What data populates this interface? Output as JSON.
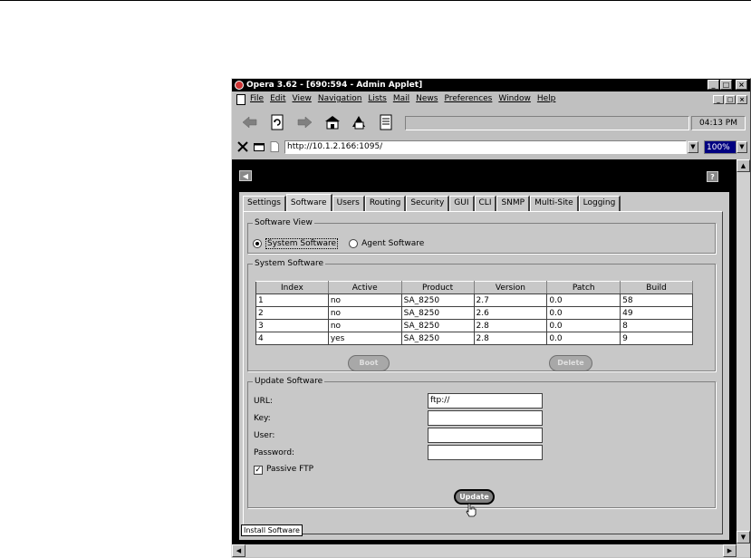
{
  "window": {
    "title": "Opera 3.62 - [690:594 - Admin Applet]",
    "controls": [
      "_",
      "□",
      "×"
    ]
  },
  "menu": {
    "items": [
      "File",
      "Edit",
      "View",
      "Navigation",
      "Lists",
      "Mail",
      "News",
      "Preferences",
      "Window",
      "Help"
    ]
  },
  "toolbar": {
    "icons": [
      "back-arrow-icon",
      "reload-icon",
      "forward-arrow-icon",
      "home-icon",
      "hotlist-icon",
      "notes-icon"
    ],
    "clock": "04:13 PM"
  },
  "address": {
    "url": "http://10.1.2.166:1095/",
    "zoom": "100%"
  },
  "applet": {
    "tabs": [
      "Settings",
      "Software",
      "Users",
      "Routing",
      "Security",
      "GUI",
      "CLI",
      "SNMP",
      "Multi-Site",
      "Logging"
    ],
    "active_tab": "Software",
    "software_view": {
      "legend": "Software View",
      "options": [
        "System Software",
        "Agent Software"
      ],
      "selected": "System Software"
    },
    "system_software": {
      "legend": "System Software",
      "columns": [
        "Index",
        "Active",
        "Product",
        "Version",
        "Patch",
        "Build"
      ],
      "rows": [
        [
          "1",
          "no",
          "SA_8250",
          "2.7",
          "0.0",
          "58"
        ],
        [
          "2",
          "no",
          "SA_8250",
          "2.6",
          "0.0",
          "49"
        ],
        [
          "3",
          "no",
          "SA_8250",
          "2.8",
          "0.0",
          "8"
        ],
        [
          "4",
          "yes",
          "SA_8250",
          "2.8",
          "0.0",
          "9"
        ]
      ],
      "boot_label": "Boot",
      "delete_label": "Delete"
    },
    "update_software": {
      "legend": "Update Software",
      "fields": [
        {
          "label": "URL:",
          "value": "ftp://"
        },
        {
          "label": "Key:",
          "value": ""
        },
        {
          "label": "User:",
          "value": ""
        },
        {
          "label": "Password:",
          "value": ""
        }
      ],
      "passive_ftp_label": "Passive FTP",
      "passive_ftp_checked": true,
      "update_label": "Update",
      "tooltip": "Install Software"
    }
  }
}
